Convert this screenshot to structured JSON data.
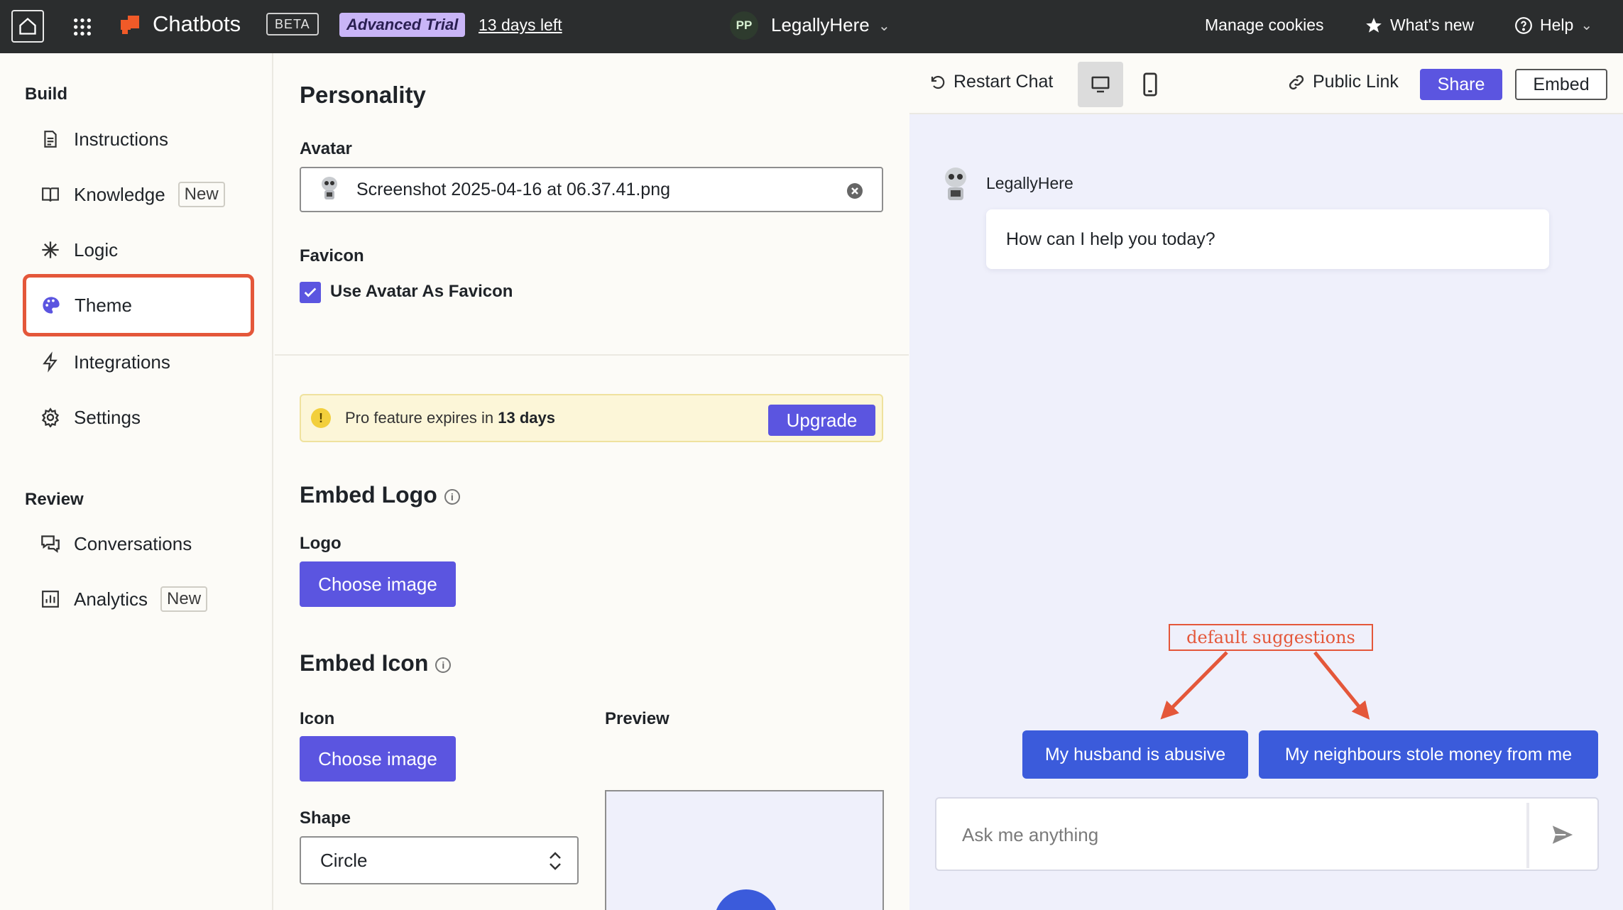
{
  "topbar": {
    "app_name": "Chatbots",
    "beta_label": "BETA",
    "trial_label": "Advanced Trial",
    "days_left": "13 days left",
    "workspace_initials": "PP",
    "workspace_name": "LegallyHere",
    "manage_cookies": "Manage cookies",
    "whats_new": "What's new",
    "help": "Help"
  },
  "sidebar": {
    "build_heading": "Build",
    "review_heading": "Review",
    "items": [
      {
        "label": "Instructions",
        "icon": "document-icon"
      },
      {
        "label": "Knowledge",
        "icon": "book-icon",
        "badge": "New"
      },
      {
        "label": "Logic",
        "icon": "asterisk-icon"
      },
      {
        "label": "Theme",
        "icon": "palette-icon",
        "active": true
      },
      {
        "label": "Integrations",
        "icon": "lightning-icon"
      },
      {
        "label": "Settings",
        "icon": "gear-icon"
      }
    ],
    "review_items": [
      {
        "label": "Conversations",
        "icon": "chat-bubbles-icon"
      },
      {
        "label": "Analytics",
        "icon": "bar-chart-icon",
        "badge": "New"
      }
    ]
  },
  "personality": {
    "title": "Personality",
    "avatar_label": "Avatar",
    "avatar_file": "Screenshot 2025-04-16 at 06.37.41.png",
    "favicon_label": "Favicon",
    "use_avatar_favicon": "Use Avatar As Favicon",
    "use_avatar_favicon_checked": true
  },
  "pro_banner": {
    "text_prefix": "Pro feature expires in ",
    "text_bold": "13 days",
    "upgrade": "Upgrade"
  },
  "embed_logo": {
    "title": "Embed Logo",
    "logo_label": "Logo",
    "choose_image": "Choose image"
  },
  "embed_icon": {
    "title": "Embed Icon",
    "icon_label": "Icon",
    "choose_image": "Choose image",
    "preview_label": "Preview",
    "shape_label": "Shape",
    "shape_value": "Circle"
  },
  "preview_toolbar": {
    "restart_chat": "Restart Chat",
    "public_link": "Public Link",
    "share": "Share",
    "embed": "Embed"
  },
  "chat": {
    "bot_name": "LegallyHere",
    "greeting": "How can I help you today?",
    "annotation": "default suggestions",
    "suggestions": [
      "My husband is abusive",
      "My neighbours stole money from me"
    ],
    "input_placeholder": "Ask me anything"
  },
  "colors": {
    "accent": "#5b55e0",
    "chat_accent": "#3b5bdb",
    "highlight": "#e4573a",
    "topbar": "#2b2d2e"
  }
}
